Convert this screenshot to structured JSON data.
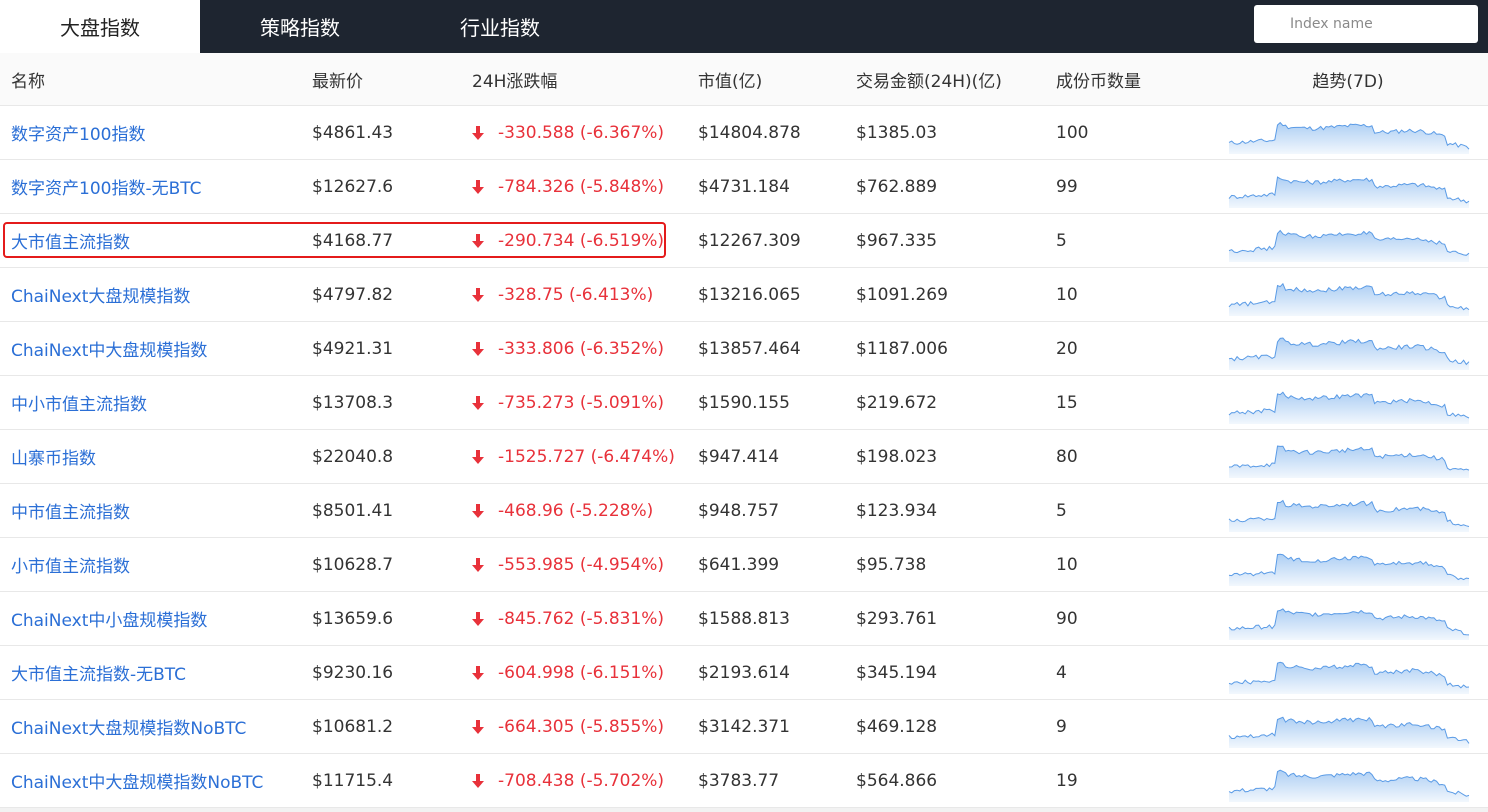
{
  "tabs": [
    {
      "label": "大盘指数",
      "active": true
    },
    {
      "label": "策略指数",
      "active": false
    },
    {
      "label": "行业指数",
      "active": false
    }
  ],
  "search": {
    "placeholder": "Index name",
    "value": ""
  },
  "table": {
    "columns": {
      "name": "名称",
      "price": "最新价",
      "change": "24H涨跌幅",
      "cap": "市值(亿)",
      "volume": "交易金额(24H)(亿)",
      "count": "成份币数量",
      "trend": "趋势(7D)"
    },
    "rows": [
      {
        "name": "数字资产100指数",
        "price": "$4861.43",
        "change": "-330.588 (-6.367%)",
        "cap": "$14804.878",
        "volume": "$1385.03",
        "count": "100"
      },
      {
        "name": "数字资产100指数-无BTC",
        "price": "$12627.6",
        "change": "-784.326 (-5.848%)",
        "cap": "$4731.184",
        "volume": "$762.889",
        "count": "99"
      },
      {
        "name": "大市值主流指数",
        "price": "$4168.77",
        "change": "-290.734 (-6.519%)",
        "cap": "$12267.309",
        "volume": "$967.335",
        "count": "5"
      },
      {
        "name": "ChaiNext大盘规模指数",
        "price": "$4797.82",
        "change": "-328.75 (-6.413%)",
        "cap": "$13216.065",
        "volume": "$1091.269",
        "count": "10"
      },
      {
        "name": "ChaiNext中大盘规模指数",
        "price": "$4921.31",
        "change": "-333.806 (-6.352%)",
        "cap": "$13857.464",
        "volume": "$1187.006",
        "count": "20"
      },
      {
        "name": "中小市值主流指数",
        "price": "$13708.3",
        "change": "-735.273 (-5.091%)",
        "cap": "$1590.155",
        "volume": "$219.672",
        "count": "15"
      },
      {
        "name": "山寨币指数",
        "price": "$22040.8",
        "change": "-1525.727 (-6.474%)",
        "cap": "$947.414",
        "volume": "$198.023",
        "count": "80"
      },
      {
        "name": "中市值主流指数",
        "price": "$8501.41",
        "change": "-468.96 (-5.228%)",
        "cap": "$948.757",
        "volume": "$123.934",
        "count": "5"
      },
      {
        "name": "小市值主流指数",
        "price": "$10628.7",
        "change": "-553.985 (-4.954%)",
        "cap": "$641.399",
        "volume": "$95.738",
        "count": "10"
      },
      {
        "name": "ChaiNext中小盘规模指数",
        "price": "$13659.6",
        "change": "-845.762 (-5.831%)",
        "cap": "$1588.813",
        "volume": "$293.761",
        "count": "90"
      },
      {
        "name": "大市值主流指数-无BTC",
        "price": "$9230.16",
        "change": "-604.998 (-6.151%)",
        "cap": "$2193.614",
        "volume": "$345.194",
        "count": "4"
      },
      {
        "name": "ChaiNext大盘规模指数NoBTC",
        "price": "$10681.2",
        "change": "-664.305 (-5.855%)",
        "cap": "$3142.371",
        "volume": "$469.128",
        "count": "9"
      },
      {
        "name": "ChaiNext中大盘规模指数NoBTC",
        "price": "$11715.4",
        "change": "-708.438 (-5.702%)",
        "cap": "$3783.77",
        "volume": "$564.866",
        "count": "19"
      }
    ]
  },
  "colors": {
    "topbar": "#1e2530",
    "link": "#2b6fd6",
    "negative": "#e8313a",
    "highlight": "#e41b1b",
    "sparkline_stroke": "#5a9be6",
    "sparkline_fill": "#a9ccf3"
  },
  "icons": {
    "change_arrow": "arrow-down-icon"
  },
  "highlighted_row": 2
}
